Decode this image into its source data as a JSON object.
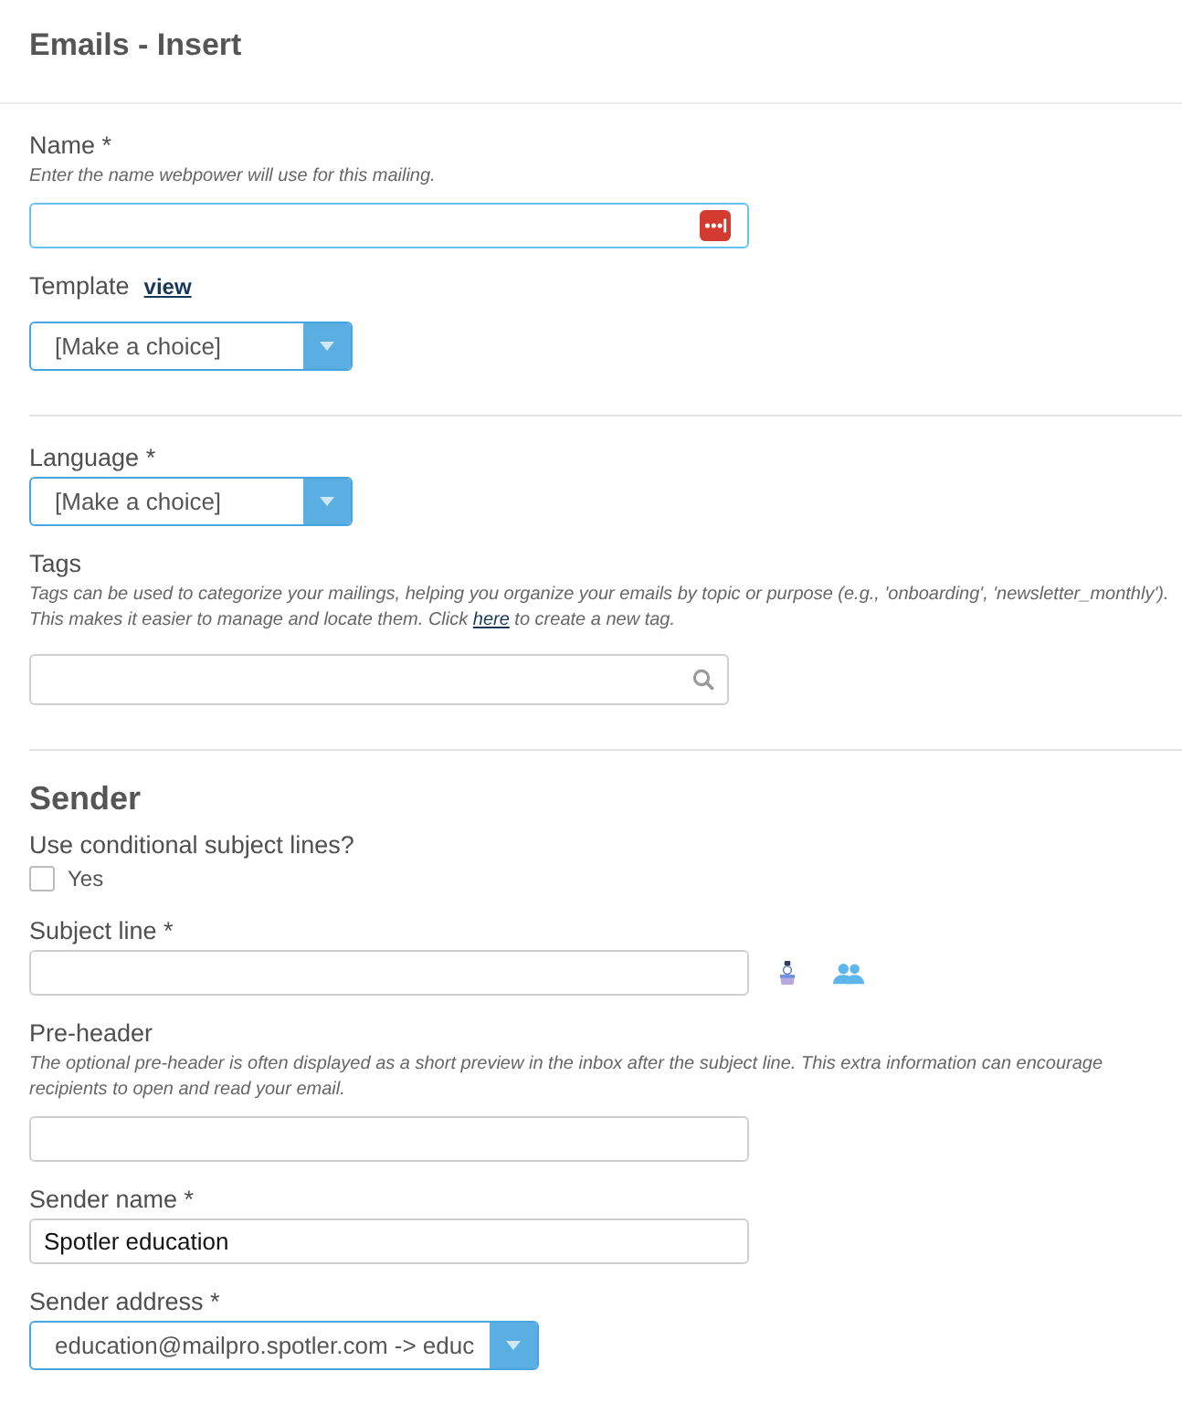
{
  "page": {
    "title": "Emails - Insert"
  },
  "sections": [
    {
      "fields": [
        {
          "kind": "text",
          "label": "Name *",
          "hint": "Enter the name webpower will use for this mailing.",
          "focused": true,
          "autofill": true
        },
        {
          "kind": "select",
          "label": "Template",
          "link": "view",
          "value": "[Make a choice]"
        }
      ]
    },
    {
      "fields": [
        {
          "kind": "select",
          "label": "Language *",
          "value": "[Make a choice]"
        },
        {
          "kind": "search",
          "label": "Tags",
          "hint": "Tags can be used to categorize your mailings, helping you organize your emails by topic or purpose (e.g., 'onboarding', 'newsletter_monthly'). This makes it easier to manage and locate them. Click",
          "hint_link": "here",
          "hint_after": "to create a new tag."
        }
      ]
    },
    {
      "heading": "Sender",
      "fields": [
        {
          "kind": "checkbox",
          "label": "Use conditional subject lines?",
          "option": "Yes",
          "checked": false
        },
        {
          "kind": "text",
          "label": "Subject line *",
          "focused": false,
          "actions": [
            {
              "kind": "figure"
            },
            {
              "kind": "users"
            }
          ]
        },
        {
          "kind": "text",
          "label": "Pre-header",
          "hint": "The optional pre-header is often displayed as a short preview in the inbox after the subject line. This extra information can encourage recipients to open and read your email.",
          "focused": false
        },
        {
          "kind": "text",
          "label": "Sender name *",
          "value": "Spotler education",
          "focused": false
        },
        {
          "kind": "select",
          "label": "Sender address *",
          "value": "education@mailpro.spotler.com -> educ"
        }
      ]
    }
  ]
}
